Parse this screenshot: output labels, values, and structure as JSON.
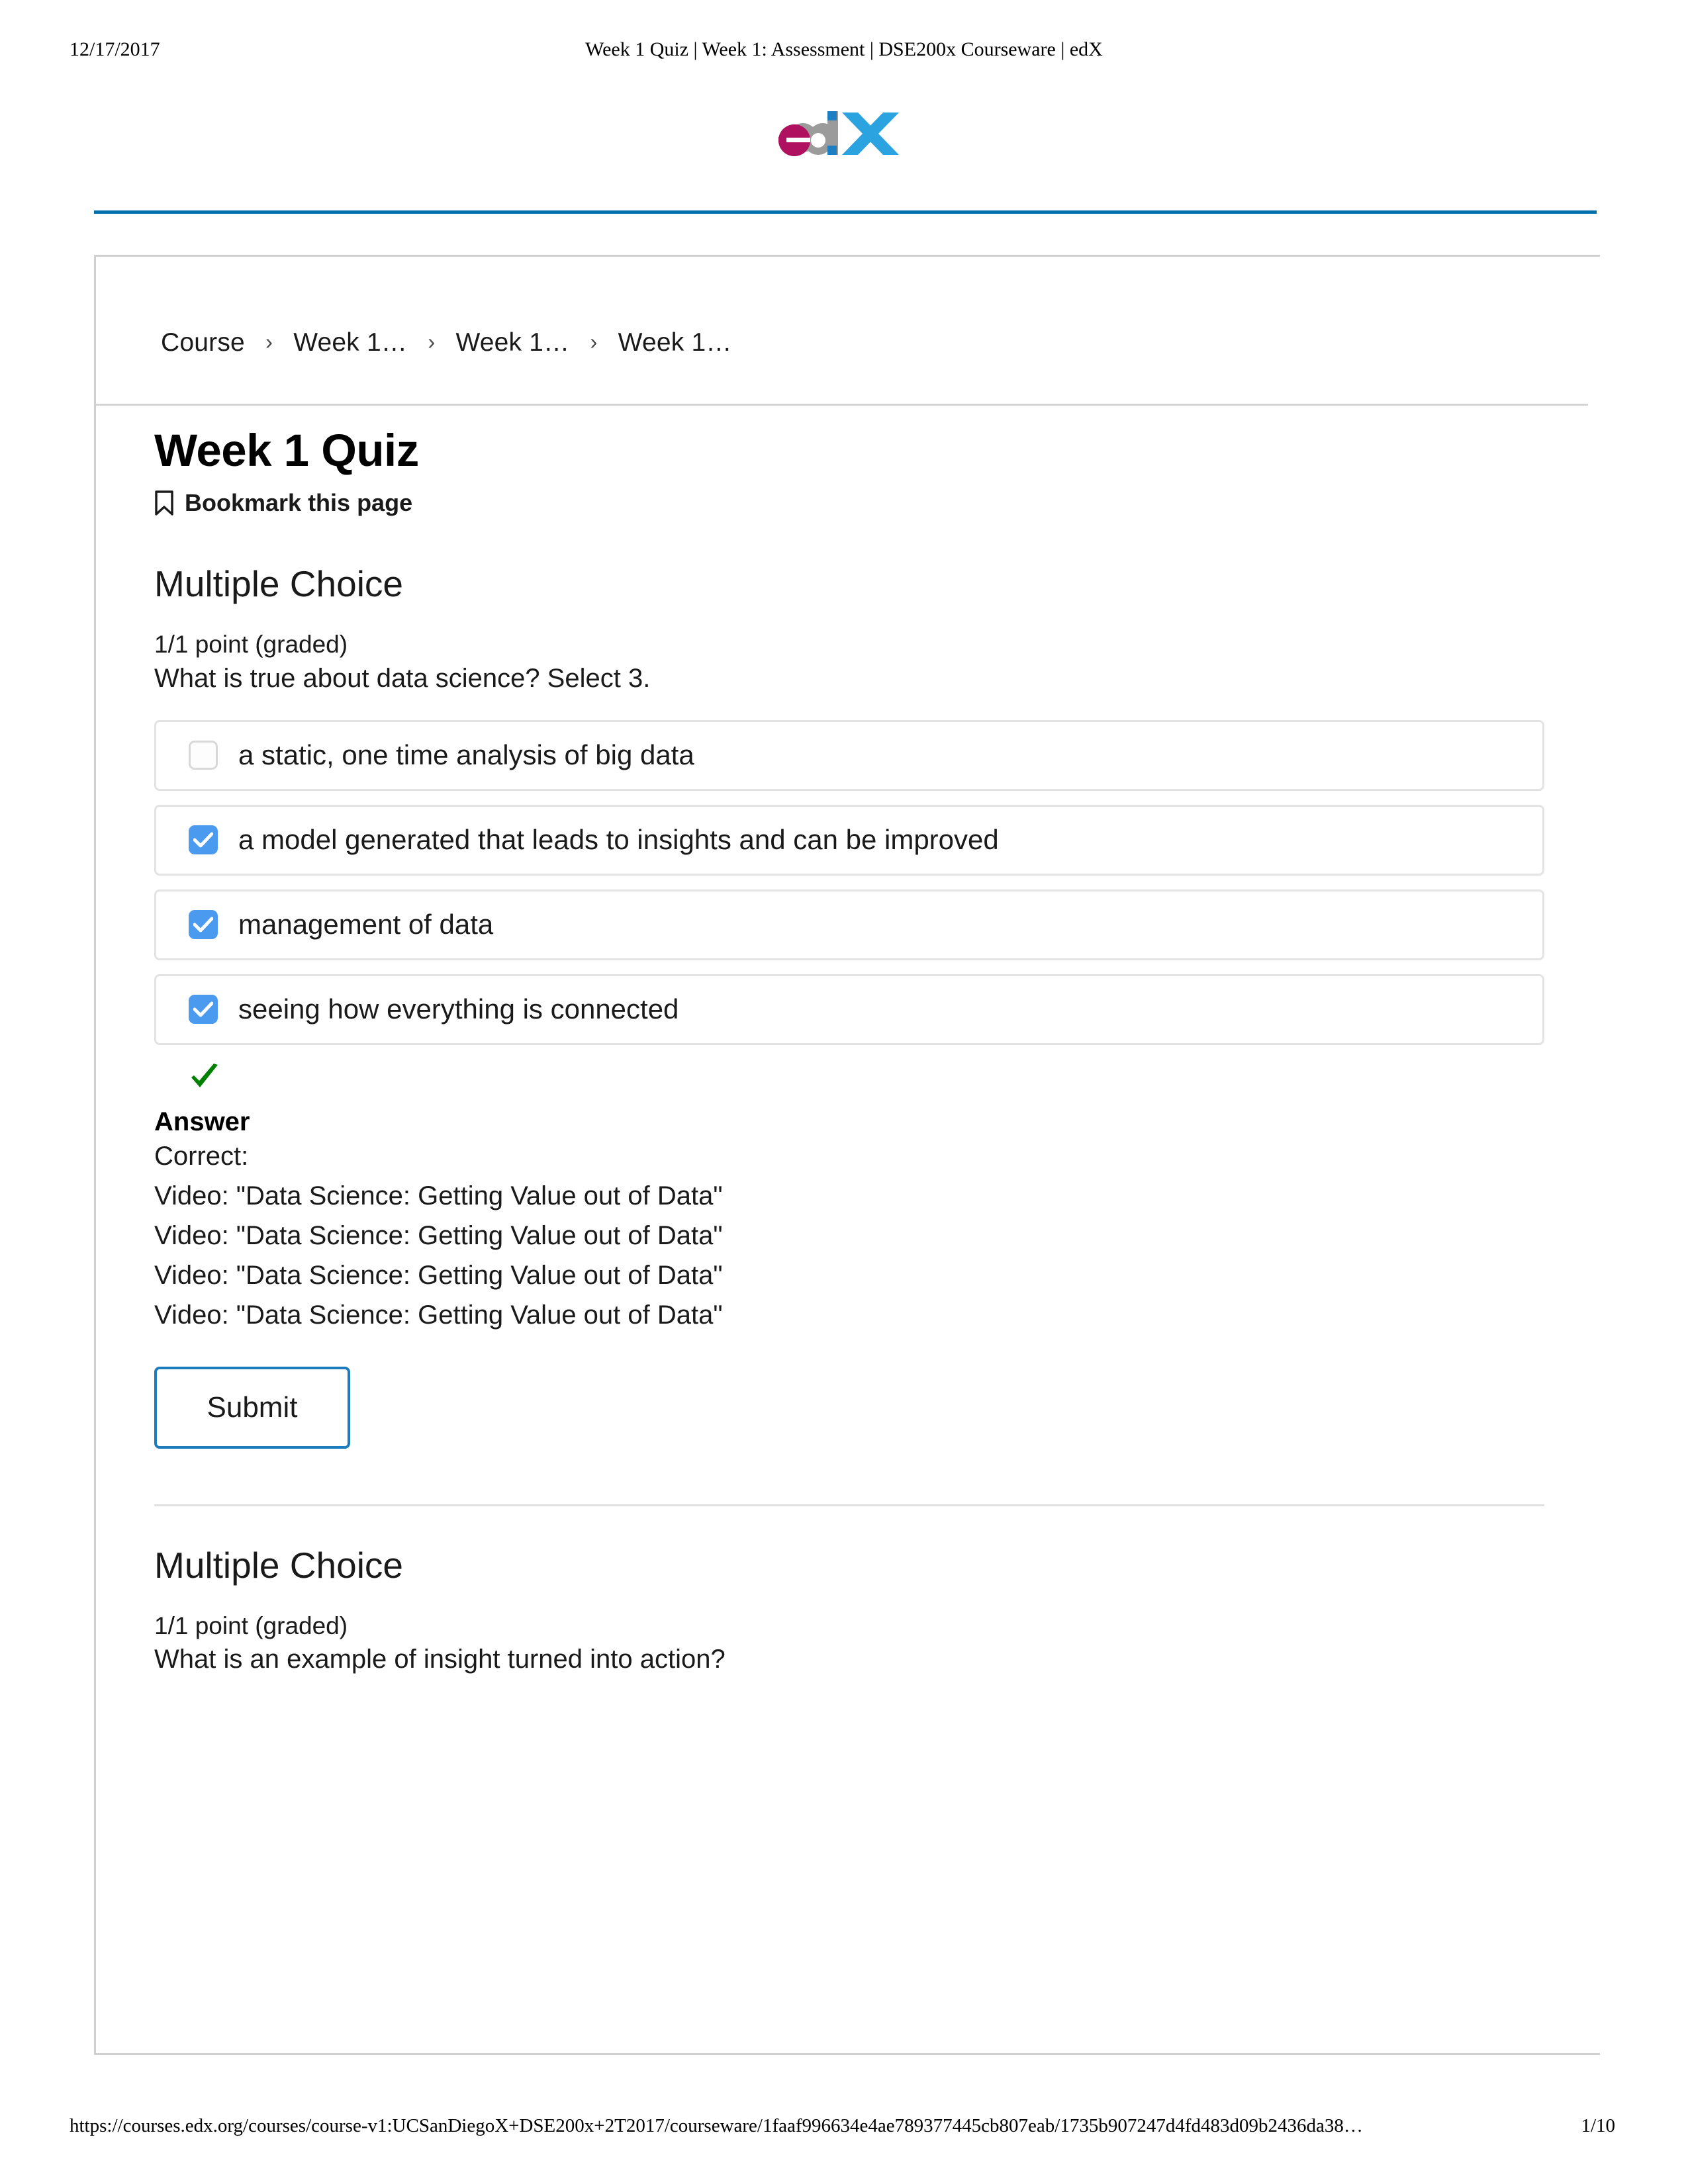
{
  "print_header": {
    "date": "12/17/2017",
    "title": "Week 1 Quiz | Week 1: Assessment | DSE200x Courseware | edX"
  },
  "brand": {
    "logo_name": "edx-logo",
    "logo_text": "edX",
    "color_e": "#b01060",
    "color_d": "#9b9b9b",
    "color_x": "#2ba3e0"
  },
  "colors": {
    "rule_blue": "#0070ad",
    "checkbox_blue": "#4a9bf0",
    "submit_border_blue": "#1b7bbd",
    "correct_green": "#008000",
    "card_border": "#cfcfcf",
    "option_border": "#e3e3e3"
  },
  "breadcrumb": {
    "items": [
      "Course",
      "Week 1…",
      "Week 1…",
      "Week 1…"
    ],
    "separator": "›"
  },
  "page": {
    "title": "Week 1 Quiz",
    "bookmark_label": "Bookmark this page",
    "bookmark_icon": "bookmark-icon"
  },
  "questions": [
    {
      "heading": "Multiple Choice",
      "points": "1/1 point (graded)",
      "prompt": "What is true about data science? Select 3.",
      "options": [
        {
          "label": "a static, one time analysis of big data",
          "checked": false
        },
        {
          "label": "a model generated that leads to insights and can be improved",
          "checked": true
        },
        {
          "label": "management of data",
          "checked": true
        },
        {
          "label": "seeing how everything is connected",
          "checked": true
        }
      ],
      "correct_icon": "check-mark-icon",
      "answer_title": "Answer",
      "answer_lines": [
        "Correct:",
        "Video: \"Data Science: Getting Value out of Data\"",
        "Video: \"Data Science: Getting Value out of Data\"",
        "Video: \"Data Science: Getting Value out of Data\"",
        "Video: \"Data Science: Getting Value out of Data\""
      ],
      "submit_label": "Submit"
    },
    {
      "heading": "Multiple Choice",
      "points": "1/1 point (graded)",
      "prompt": "What is an example of insight turned into action?"
    }
  ],
  "print_footer": {
    "url": "https://courses.edx.org/courses/course-v1:UCSanDiegoX+DSE200x+2T2017/courseware/1faaf996634e4ae789377445cb807eab/1735b907247d4fd483d09b2436da38…",
    "page": "1/10"
  }
}
